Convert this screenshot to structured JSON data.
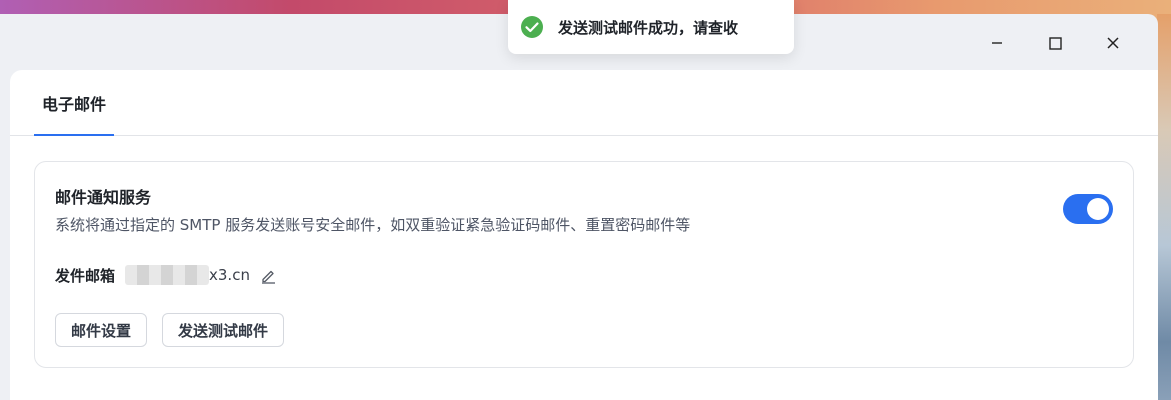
{
  "window": {
    "controls": {
      "minimize_icon": "minimize-icon",
      "maximize_icon": "maximize-icon",
      "close_icon": "close-icon"
    }
  },
  "tabs": [
    {
      "label": "电子邮件",
      "active": true
    }
  ],
  "mail_service": {
    "title": "邮件通知服务",
    "description": "系统将通过指定的 SMTP 服务发送账号安全邮件，如双重验证紧急验证码邮件、重置密码邮件等",
    "enabled": true,
    "sender_label": "发件邮箱",
    "sender_value_visible": "x3.cn",
    "edit_icon": "pencil-icon",
    "buttons": {
      "settings": "邮件设置",
      "send_test": "发送测试邮件"
    }
  },
  "toast": {
    "icon": "check-circle-icon",
    "message": "发送测试邮件成功，请查收"
  },
  "colors": {
    "accent": "#2a6ff0",
    "success": "#4caf50",
    "text_primary": "#1f2329",
    "text_secondary": "#4e5565"
  }
}
